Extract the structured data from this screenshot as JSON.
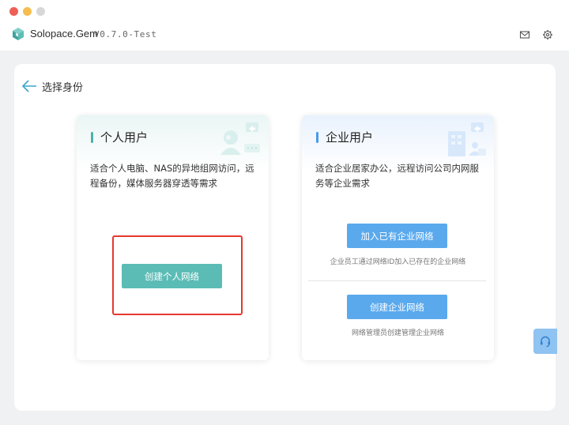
{
  "app": {
    "name": "Solopace.Gem",
    "version": "V0.7.0-Test",
    "icons": {
      "logo": "cube-logo-icon",
      "mail": "mail-icon",
      "settings": "gear-icon"
    }
  },
  "page": {
    "back_label": "选择身份",
    "back_icon": "arrow-left-icon"
  },
  "personal": {
    "title": "个人用户",
    "description": "适合个人电脑、NAS的异地组网访问，远程备份，媒体服务器穿透等需求",
    "create_button": "创建个人网络",
    "accent": "#4ab1ad"
  },
  "enterprise": {
    "title": "企业用户",
    "description": "适合企业居家办公，远程访问公司内网服务等企业需求",
    "join_button": "加入已有企业网络",
    "join_hint": "企业员工通过网络ID加入已存在的企业网络",
    "create_button": "创建企业网络",
    "create_hint": "网络管理员创建管理企业网络",
    "accent": "#4b9be8"
  },
  "colors": {
    "highlight": "#e5382e",
    "support": "#8fc3f1"
  }
}
